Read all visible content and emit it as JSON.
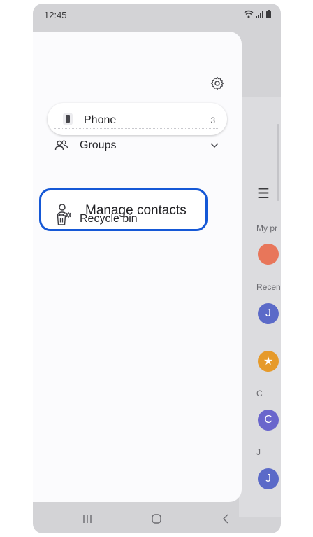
{
  "status_bar": {
    "time": "12:45"
  },
  "drawer": {
    "phone_card": {
      "label": "Phone",
      "count": "3"
    },
    "menu": {
      "groups": "Groups",
      "manage_contacts": "Manage contacts",
      "recycle_bin": "Recycle bin"
    }
  },
  "background_list": {
    "labels": {
      "my_profile": "My pr",
      "recent": "Recen",
      "section_c": "C",
      "section_j": "J"
    },
    "avatars": [
      {
        "letter": "",
        "color": "#e8765a"
      },
      {
        "letter": "J",
        "color": "#5b6ac8"
      },
      {
        "letter": "★",
        "color": "#e69a2a"
      },
      {
        "letter": "C",
        "color": "#6a66cc"
      },
      {
        "letter": "J",
        "color": "#5b6ac8"
      }
    ]
  },
  "icons": [
    "wifi-icon",
    "signal-icon",
    "battery-icon",
    "settings-icon",
    "phone-icon",
    "groups-icon",
    "chevron-down-icon",
    "manage-contacts-icon",
    "trash-icon",
    "menu-icon",
    "recent-apps-icon",
    "home-icon",
    "back-icon"
  ]
}
